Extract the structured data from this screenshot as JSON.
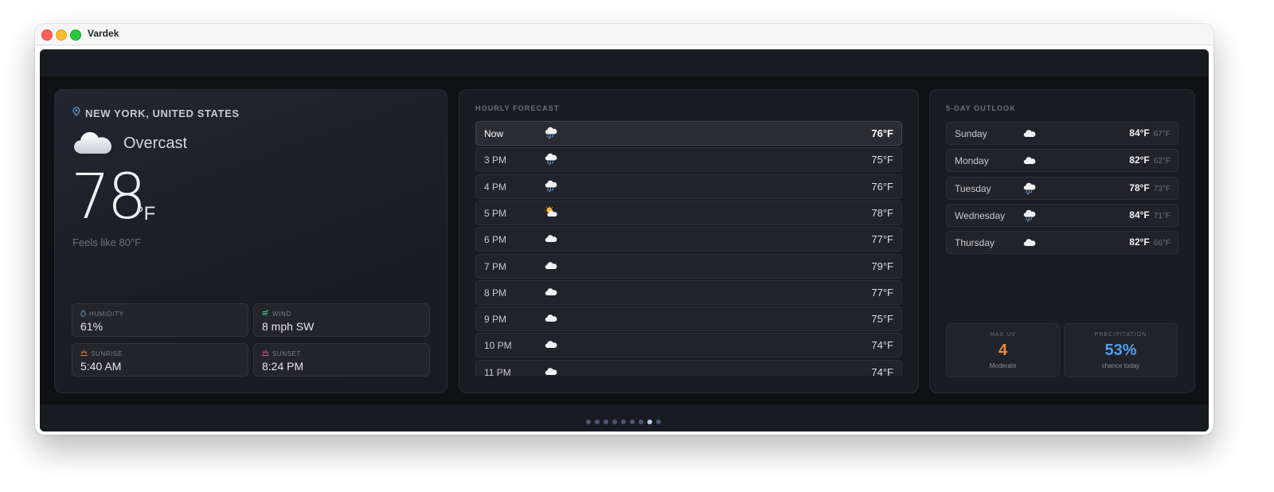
{
  "window": {
    "title": "Vardek"
  },
  "current": {
    "location": "NEW YORK, UNITED STATES",
    "condition": "Overcast",
    "condition_icon": "cloud-icon",
    "temperature": "78",
    "unit": "°F",
    "feels_like": "Feels like 80°F",
    "stats": [
      {
        "label": "HUMIDITY",
        "value": "61%",
        "icon": "droplet-icon",
        "color": "#5b9bd5"
      },
      {
        "label": "WIND",
        "value": "8 mph SW",
        "icon": "wind-icon",
        "color": "#3fbf7f"
      },
      {
        "label": "SUNRISE",
        "value": "5:40 AM",
        "icon": "sunrise-icon",
        "color": "#e8873a"
      },
      {
        "label": "SUNSET",
        "value": "8:24 PM",
        "icon": "sunset-icon",
        "color": "#d65a9a"
      }
    ]
  },
  "hourly": {
    "title": "HOURLY FORECAST",
    "items": [
      {
        "time": "Now",
        "temp": "76°F",
        "icon": "rain-cloud-icon"
      },
      {
        "time": "3 PM",
        "temp": "75°F",
        "icon": "rain-cloud-icon"
      },
      {
        "time": "4 PM",
        "temp": "76°F",
        "icon": "rain-cloud-icon"
      },
      {
        "time": "5 PM",
        "temp": "78°F",
        "icon": "sun-behind-cloud-icon"
      },
      {
        "time": "6 PM",
        "temp": "77°F",
        "icon": "cloud-icon"
      },
      {
        "time": "7 PM",
        "temp": "79°F",
        "icon": "cloud-icon"
      },
      {
        "time": "8 PM",
        "temp": "77°F",
        "icon": "cloud-icon"
      },
      {
        "time": "9 PM",
        "temp": "75°F",
        "icon": "cloud-icon"
      },
      {
        "time": "10 PM",
        "temp": "74°F",
        "icon": "cloud-icon"
      },
      {
        "time": "11 PM",
        "temp": "74°F",
        "icon": "cloud-icon"
      }
    ]
  },
  "daily": {
    "title": "5-DAY OUTLOOK",
    "items": [
      {
        "day": "Sunday",
        "hi": "84°F",
        "lo": "67°F",
        "icon": "cloud-icon"
      },
      {
        "day": "Monday",
        "hi": "82°F",
        "lo": "62°F",
        "icon": "cloud-icon"
      },
      {
        "day": "Tuesday",
        "hi": "78°F",
        "lo": "73°F",
        "icon": "rain-cloud-icon"
      },
      {
        "day": "Wednesday",
        "hi": "84°F",
        "lo": "71°F",
        "icon": "rain-cloud-icon"
      },
      {
        "day": "Thursday",
        "hi": "82°F",
        "lo": "66°F",
        "icon": "cloud-icon"
      }
    ]
  },
  "uv": {
    "label": "MAX UV",
    "value": "4",
    "sub": "Moderate",
    "color": "#f08a3c"
  },
  "precip": {
    "label": "PRECIPITATION",
    "value": "53%",
    "sub": "chance today",
    "color": "#4f9cf0"
  },
  "pager": {
    "count": 9,
    "active_index": 7
  },
  "colors": {
    "background": "#101114",
    "card": "#1b1c21",
    "accent_location_pin": "#5b9bd5"
  }
}
